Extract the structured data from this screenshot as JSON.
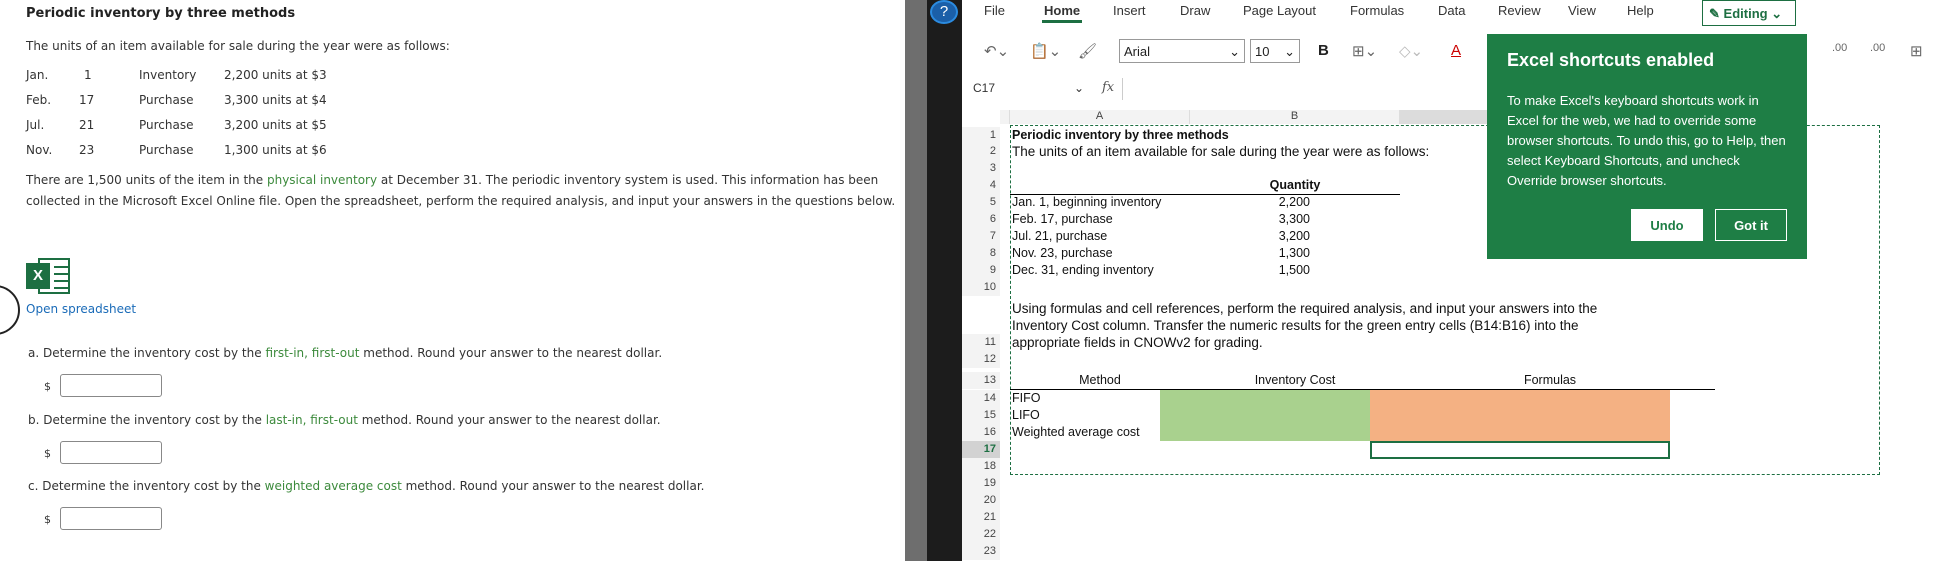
{
  "left": {
    "title": "Periodic inventory by three methods",
    "intro": "The units of an item available for sale during the year were as follows:",
    "units": [
      {
        "month": "Jan.",
        "day": "1",
        "type": "Inventory",
        "detail": "2,200 units at $3"
      },
      {
        "month": "Feb.",
        "day": "17",
        "type": "Purchase",
        "detail": "3,300 units at $4"
      },
      {
        "month": "Jul.",
        "day": "21",
        "type": "Purchase",
        "detail": "3,200 units at $5"
      },
      {
        "month": "Nov.",
        "day": "23",
        "type": "Purchase",
        "detail": "1,300 units at $6"
      }
    ],
    "para_a": "There are 1,500 units of the item in the ",
    "para_link": "physical inventory",
    "para_b": " at December 31. The periodic inventory system is used. This information has been collected in the Microsoft Excel Online file. Open the spreadsheet, perform the required analysis, and input your answers in the questions below.",
    "excel_badge": "X",
    "open_link": "Open spreadsheet",
    "questions": [
      {
        "pre": "a. Determine the inventory cost by the ",
        "link": "first-in, first-out",
        "post": " method. Round your answer to the nearest dollar.",
        "dollar": "$"
      },
      {
        "pre": "b. Determine the inventory cost by the ",
        "link": "last-in, first-out",
        "post": " method. Round your answer to the nearest dollar.",
        "dollar": "$"
      },
      {
        "pre": "c. Determine the inventory cost by the ",
        "link": "weighted average cost",
        "post": " method. Round your answer to the nearest dollar.",
        "dollar": "$"
      }
    ]
  },
  "help_glyph": "?",
  "excel": {
    "tabs": [
      "File",
      "Home",
      "Insert",
      "Draw",
      "Page Layout",
      "Formulas",
      "Data",
      "Review",
      "View",
      "Help"
    ],
    "active_tab": "Home",
    "editing_label": "Editing",
    "font": "Arial",
    "font_size": "10",
    "bold_glyph": "B",
    "font_color_glyph": "A",
    "dec_inc": ".00",
    "name_box": "C17",
    "fx_glyph": "fx",
    "col_a": "A",
    "col_b": "B",
    "rows": [
      "1",
      "2",
      "3",
      "4",
      "5",
      "6",
      "7",
      "8",
      "9",
      "10",
      "11",
      "12",
      "13",
      "14",
      "15",
      "16",
      "17",
      "18",
      "19",
      "20",
      "21",
      "22",
      "23"
    ],
    "sheet_title": "Periodic inventory by three methods",
    "sheet_intro": "The units of an item available for sale during the year were as follows:",
    "quantity_header": "Quantity",
    "items": [
      {
        "label": "Jan. 1, beginning inventory",
        "qty": "2,200"
      },
      {
        "label": "Feb. 17, purchase",
        "qty": "3,300"
      },
      {
        "label": "Jul. 21, purchase",
        "qty": "3,200"
      },
      {
        "label": "Nov. 23, purchase",
        "qty": "1,300"
      },
      {
        "label": "Dec. 31, ending inventory",
        "qty": "1,500"
      }
    ],
    "instructions_1": "Using formulas and cell references, perform the required analysis, and input your answers into the",
    "instructions_2": "Inventory Cost column. Transfer the numeric results for the green entry cells (B14:B16) into the",
    "instructions_3": "appropriate fields in CNOWv2 for grading.",
    "method_header": "Method",
    "cost_header": "Inventory Cost",
    "formulas_header": "Formulas",
    "methods": [
      "FIFO",
      "LIFO",
      "Weighted average cost"
    ]
  },
  "toast": {
    "title": "Excel shortcuts enabled",
    "body": "To make Excel's keyboard shortcuts work in Excel for the web, we had to override some browser shortcuts. To undo this, go to Help, then select Keyboard Shortcuts, and uncheck Override browser shortcuts.",
    "undo": "Undo",
    "got_it": "Got it"
  },
  "colors": {
    "excel_green": "#1d6f42",
    "entry_green": "#a9d18e",
    "entry_orange": "#f4b183",
    "toast_bg": "#1e7e45",
    "link_green": "#3c8a3c"
  }
}
